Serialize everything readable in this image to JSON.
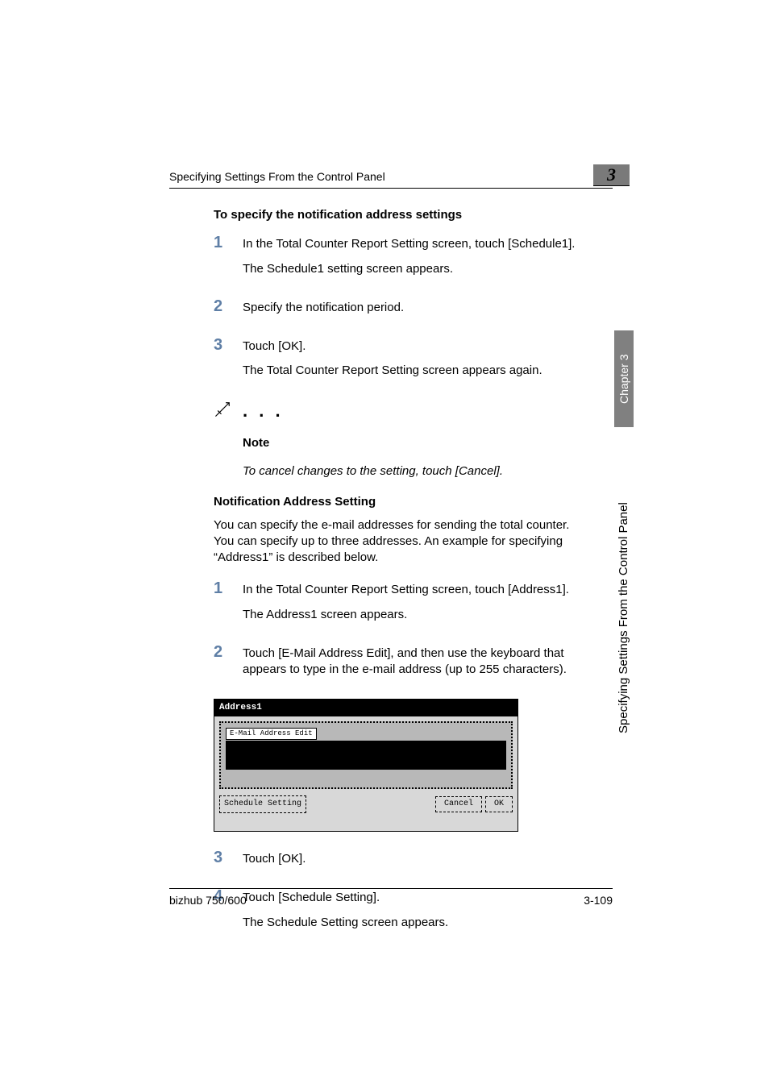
{
  "header": {
    "running": "Specifying Settings From the Control Panel",
    "chapnum": "3"
  },
  "side": {
    "chapter": "Chapter 3",
    "title": "Specifying Settings From the Control Panel"
  },
  "sec1": {
    "heading": "To specify the notification address settings",
    "steps": [
      {
        "n": "1",
        "t1": "In the Total Counter Report Setting screen, touch [Schedule1].",
        "t2": "The Schedule1 setting screen appears."
      },
      {
        "n": "2",
        "t1": "Specify the notification period."
      },
      {
        "n": "3",
        "t1": "Touch [OK].",
        "t2": "The Total Counter Report Setting screen appears again."
      }
    ],
    "note_dots": ". . .",
    "note_label": "Note",
    "note_text": "To cancel changes to the setting, touch [Cancel]."
  },
  "sec2": {
    "heading": "Notification Address Setting",
    "intro": "You can specify the e-mail addresses for sending the total counter. You can specify up to three addresses. An example for specifying “Address1” is described below.",
    "steps_a": [
      {
        "n": "1",
        "t1": "In the Total Counter Report Setting screen, touch [Address1].",
        "t2": "The Address1 screen appears."
      },
      {
        "n": "2",
        "t1": "Touch [E-Mail Address Edit], and then use the keyboard that appears to type in the e-mail address (up to 255 characters)."
      }
    ],
    "panel": {
      "title": "Address1",
      "email_btn": "E-Mail Address Edit",
      "schedule_btn": "Schedule Setting",
      "cancel": "Cancel",
      "ok": "OK"
    },
    "steps_b": [
      {
        "n": "3",
        "t1": "Touch [OK]."
      },
      {
        "n": "4",
        "t1": "Touch [Schedule Setting].",
        "t2": "The Schedule Setting screen appears."
      }
    ]
  },
  "footer": {
    "left": "bizhub 750/600",
    "right": "3-109"
  }
}
